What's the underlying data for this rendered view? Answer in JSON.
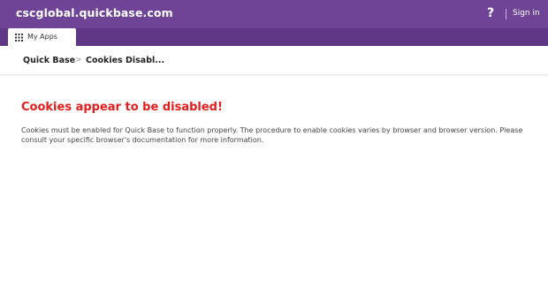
{
  "header": {
    "site_title": "cscglobal.quickbase.com",
    "help_symbol": "?",
    "sign_in_label": "Sign in"
  },
  "tabs": {
    "my_apps_label": "My Apps",
    "icon": "grid-icon"
  },
  "breadcrumb": {
    "items": [
      "Quick Base",
      "Cookies Disabl..."
    ],
    "separator": ">"
  },
  "message": {
    "heading": "Cookies appear to be disabled!",
    "body": "Cookies must be enabled for Quick Base to function properly. The procedure to enable cookies varies by browser and browser version. Please consult your specific browser's documentation for more information."
  },
  "colors": {
    "header_bg": "#6f4496",
    "tabbar_bg": "#5e3887",
    "error_red": "#e61c1c"
  }
}
